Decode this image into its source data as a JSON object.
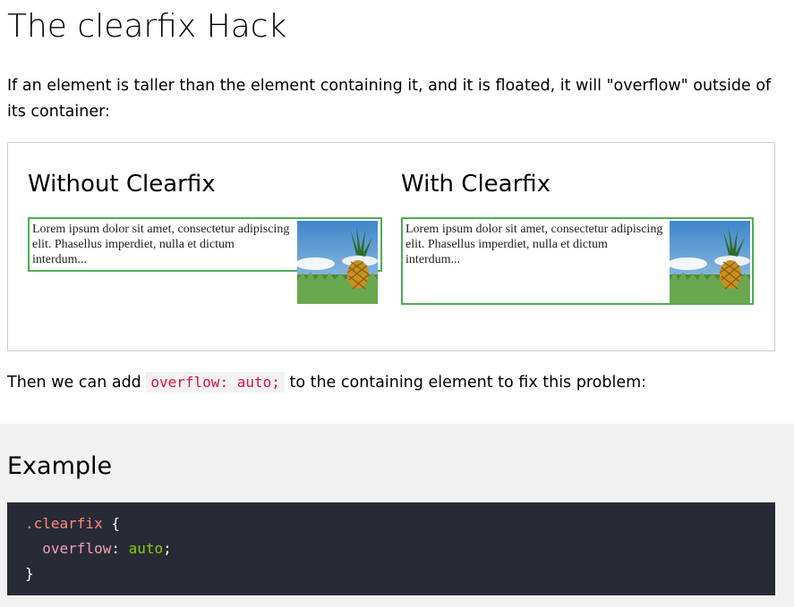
{
  "title": "The clearfix Hack",
  "intro": "If an element is taller than the element containing it, and it is floated, it will \"overflow\" outside of its container:",
  "demo": {
    "left_heading": "Without Clearfix",
    "right_heading": "With Clearfix",
    "lorem": "Lorem ipsum dolor sit amet, consectetur adipiscing elit. Phasellus imperdiet, nulla et dictum interdum...",
    "border_color": "#4caf50"
  },
  "then": {
    "before": "Then we can add",
    "code": "overflow: auto;",
    "after": "to the containing element to fix this problem:"
  },
  "example": {
    "heading": "Example",
    "code": {
      "selector": ".clearfix",
      "open_brace": "{",
      "property": "overflow",
      "colon": ":",
      "value": "auto",
      "semicolon": ";",
      "close_brace": "}"
    }
  },
  "colors": {
    "code_bg": "#282a35",
    "inline_code_text": "#dc143c",
    "panel_bg": "#f1f1f1"
  }
}
